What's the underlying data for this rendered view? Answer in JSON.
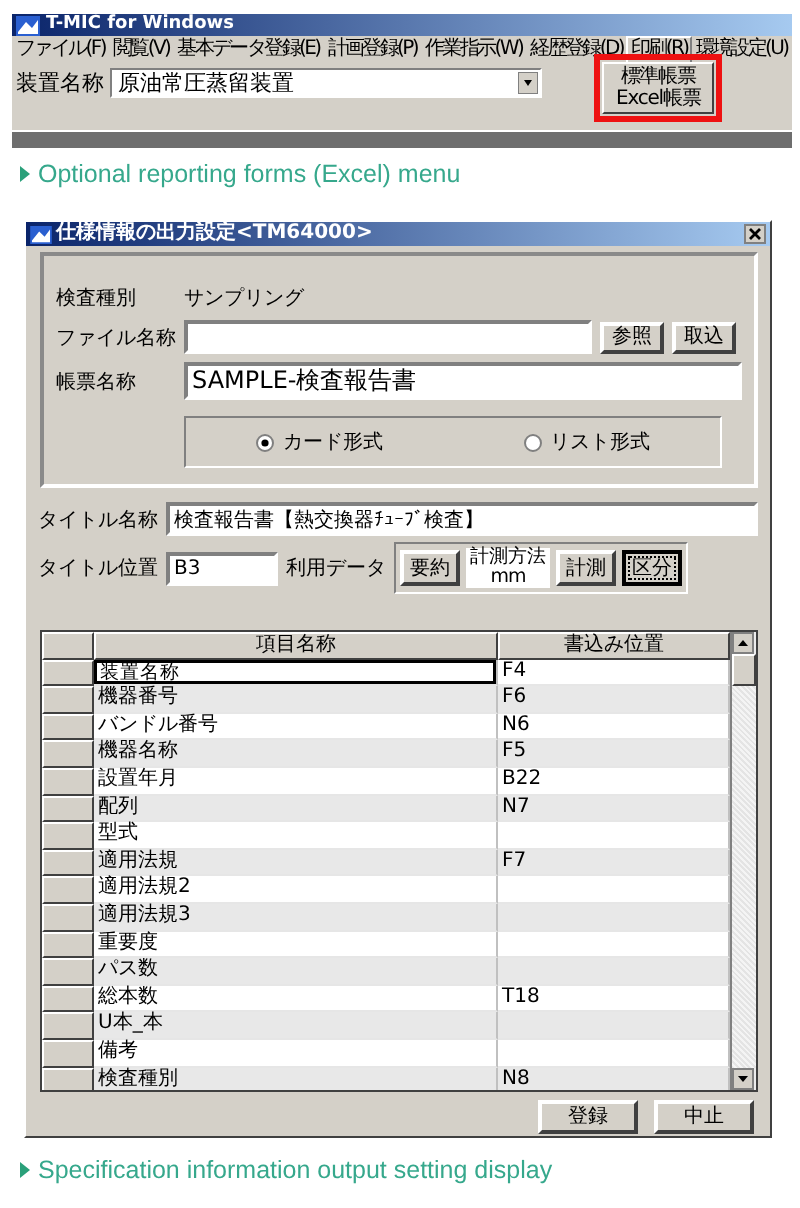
{
  "app_window": {
    "title": "T-MIC for Windows",
    "menu": [
      {
        "label": "ファイル(F)",
        "selected": false
      },
      {
        "label": "閲覧(V)",
        "selected": false
      },
      {
        "label": "基本データ登録(E)",
        "selected": false
      },
      {
        "label": "計画登録(P)",
        "selected": false
      },
      {
        "label": "作業指示(W)",
        "selected": false
      },
      {
        "label": "経歴登録(D)",
        "selected": false
      },
      {
        "label": "印刷(R)",
        "selected": true
      },
      {
        "label": "環境設定(U)",
        "selected": false
      }
    ],
    "device_label": "装置名称",
    "device_value": "原油常圧蒸留装置",
    "popup_menu": [
      "標準帳票",
      "Excel帳票"
    ]
  },
  "caption_1": "Optional reporting forms (Excel) menu",
  "dialog": {
    "title": "仕様情報の出力設定<TM64000>",
    "inspection_type_label": "検査種別",
    "inspection_type_value": "サンプリング",
    "file_name_label": "ファイル名称",
    "browse_button": "参照",
    "import_button": "取込",
    "form_name_label": "帳票名称",
    "form_name_value": "SAMPLE-検査報告書",
    "layout_options": [
      {
        "label": "カード形式",
        "selected": true
      },
      {
        "label": "リスト形式",
        "selected": false
      }
    ],
    "title_name_label": "タイトル名称",
    "title_name_value": "検査報告書【熱交換器ﾁｭｰﾌﾞ検査】",
    "title_position_label": "タイトル位置",
    "title_position_value": "B3",
    "usage_data_label": "利用データ",
    "summary_button": "要約",
    "measurement_method_label": "計測方法",
    "measurement_unit": "mm",
    "measure_button": "計測",
    "category_button": "区分",
    "table": {
      "columns": [
        "項目名称",
        "書込み位置"
      ],
      "rows": [
        {
          "name": "装置名称",
          "position": "F4",
          "selected": true
        },
        {
          "name": "機器番号",
          "position": "F6",
          "selected": false
        },
        {
          "name": "バンドル番号",
          "position": "N6",
          "selected": false
        },
        {
          "name": "機器名称",
          "position": "F5",
          "selected": false
        },
        {
          "name": "設置年月",
          "position": "B22",
          "selected": false
        },
        {
          "name": "配列",
          "position": "N7",
          "selected": false
        },
        {
          "name": "型式",
          "selected": false
        },
        {
          "name": "適用法規",
          "position": "F7",
          "selected": false
        },
        {
          "name": "適用法規2",
          "selected": false
        },
        {
          "name": "適用法規3",
          "selected": false
        },
        {
          "name": "重要度",
          "selected": false
        },
        {
          "name": "パス数",
          "selected": false
        },
        {
          "name": "総本数",
          "position": "T18",
          "selected": false
        },
        {
          "name": "U本_本",
          "selected": false
        },
        {
          "name": "備考",
          "selected": false
        },
        {
          "name": "検査種別",
          "position": "N8",
          "selected": false
        }
      ]
    },
    "register_button": "登録",
    "cancel_button": "中止"
  },
  "caption_2": "Specification information output setting display"
}
